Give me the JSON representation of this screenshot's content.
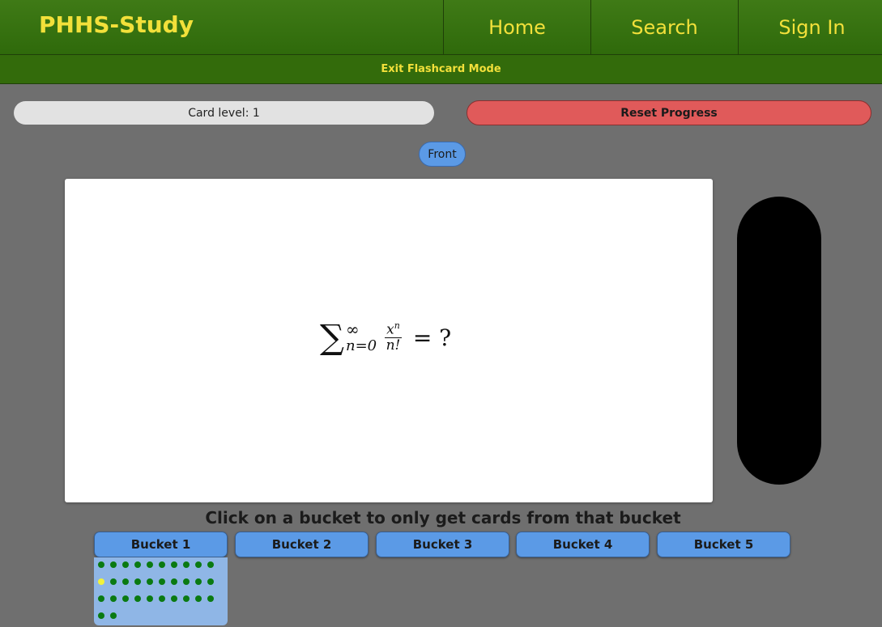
{
  "header": {
    "brand": "PHHS-Study",
    "nav": [
      "Home",
      "Search",
      "Sign In"
    ],
    "exit_link": "Exit Flashcard Mode"
  },
  "controls": {
    "card_level": "Card level: 1",
    "reset": "Reset Progress",
    "side_toggle": "Front"
  },
  "card": {
    "front_formula": {
      "sigma": "∑",
      "upper": "∞",
      "lower": "n=0",
      "numerator": "x",
      "numerator_exp": "n",
      "denominator": "n!",
      "rhs": "= ?"
    }
  },
  "buckets": {
    "hint": "Click on a bucket to only get cards from that bucket",
    "items": [
      "Bucket 1",
      "Bucket 2",
      "Bucket 3",
      "Bucket 4",
      "Bucket 5"
    ],
    "selected": 0,
    "bucket1_card_count": 32,
    "bucket1_current_card": 11
  },
  "colors": {
    "header_bg": "#336b0b",
    "brand_text": "#f2e03a",
    "reset_bg": "#e05a5a",
    "bucket_bg": "#5b9ae6",
    "dot": "#0a7a12",
    "dot_current": "#f2f23a"
  }
}
